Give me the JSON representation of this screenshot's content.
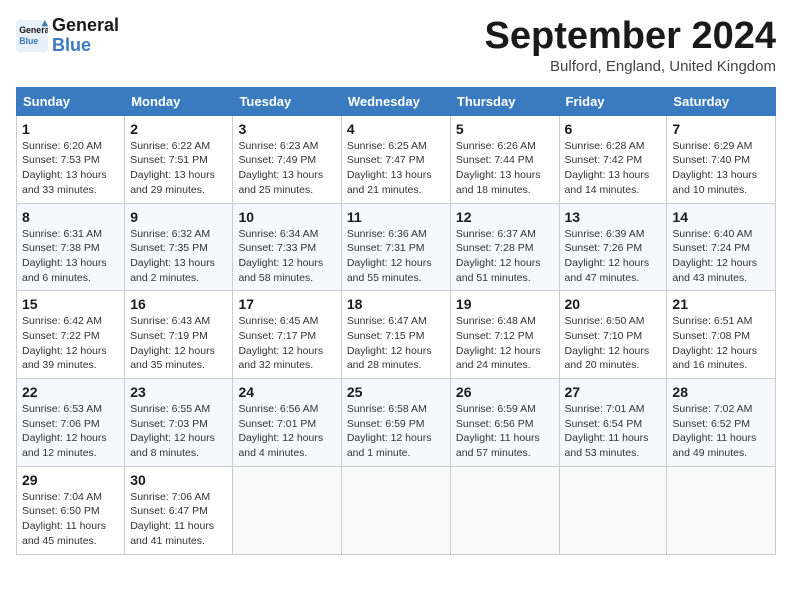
{
  "logo": {
    "line1": "General",
    "line2": "Blue"
  },
  "title": "September 2024",
  "location": "Bulford, England, United Kingdom",
  "days_header": [
    "Sunday",
    "Monday",
    "Tuesday",
    "Wednesday",
    "Thursday",
    "Friday",
    "Saturday"
  ],
  "weeks": [
    [
      {
        "num": "1",
        "info": "Sunrise: 6:20 AM\nSunset: 7:53 PM\nDaylight: 13 hours\nand 33 minutes."
      },
      {
        "num": "2",
        "info": "Sunrise: 6:22 AM\nSunset: 7:51 PM\nDaylight: 13 hours\nand 29 minutes."
      },
      {
        "num": "3",
        "info": "Sunrise: 6:23 AM\nSunset: 7:49 PM\nDaylight: 13 hours\nand 25 minutes."
      },
      {
        "num": "4",
        "info": "Sunrise: 6:25 AM\nSunset: 7:47 PM\nDaylight: 13 hours\nand 21 minutes."
      },
      {
        "num": "5",
        "info": "Sunrise: 6:26 AM\nSunset: 7:44 PM\nDaylight: 13 hours\nand 18 minutes."
      },
      {
        "num": "6",
        "info": "Sunrise: 6:28 AM\nSunset: 7:42 PM\nDaylight: 13 hours\nand 14 minutes."
      },
      {
        "num": "7",
        "info": "Sunrise: 6:29 AM\nSunset: 7:40 PM\nDaylight: 13 hours\nand 10 minutes."
      }
    ],
    [
      {
        "num": "8",
        "info": "Sunrise: 6:31 AM\nSunset: 7:38 PM\nDaylight: 13 hours\nand 6 minutes."
      },
      {
        "num": "9",
        "info": "Sunrise: 6:32 AM\nSunset: 7:35 PM\nDaylight: 13 hours\nand 2 minutes."
      },
      {
        "num": "10",
        "info": "Sunrise: 6:34 AM\nSunset: 7:33 PM\nDaylight: 12 hours\nand 58 minutes."
      },
      {
        "num": "11",
        "info": "Sunrise: 6:36 AM\nSunset: 7:31 PM\nDaylight: 12 hours\nand 55 minutes."
      },
      {
        "num": "12",
        "info": "Sunrise: 6:37 AM\nSunset: 7:28 PM\nDaylight: 12 hours\nand 51 minutes."
      },
      {
        "num": "13",
        "info": "Sunrise: 6:39 AM\nSunset: 7:26 PM\nDaylight: 12 hours\nand 47 minutes."
      },
      {
        "num": "14",
        "info": "Sunrise: 6:40 AM\nSunset: 7:24 PM\nDaylight: 12 hours\nand 43 minutes."
      }
    ],
    [
      {
        "num": "15",
        "info": "Sunrise: 6:42 AM\nSunset: 7:22 PM\nDaylight: 12 hours\nand 39 minutes."
      },
      {
        "num": "16",
        "info": "Sunrise: 6:43 AM\nSunset: 7:19 PM\nDaylight: 12 hours\nand 35 minutes."
      },
      {
        "num": "17",
        "info": "Sunrise: 6:45 AM\nSunset: 7:17 PM\nDaylight: 12 hours\nand 32 minutes."
      },
      {
        "num": "18",
        "info": "Sunrise: 6:47 AM\nSunset: 7:15 PM\nDaylight: 12 hours\nand 28 minutes."
      },
      {
        "num": "19",
        "info": "Sunrise: 6:48 AM\nSunset: 7:12 PM\nDaylight: 12 hours\nand 24 minutes."
      },
      {
        "num": "20",
        "info": "Sunrise: 6:50 AM\nSunset: 7:10 PM\nDaylight: 12 hours\nand 20 minutes."
      },
      {
        "num": "21",
        "info": "Sunrise: 6:51 AM\nSunset: 7:08 PM\nDaylight: 12 hours\nand 16 minutes."
      }
    ],
    [
      {
        "num": "22",
        "info": "Sunrise: 6:53 AM\nSunset: 7:06 PM\nDaylight: 12 hours\nand 12 minutes."
      },
      {
        "num": "23",
        "info": "Sunrise: 6:55 AM\nSunset: 7:03 PM\nDaylight: 12 hours\nand 8 minutes."
      },
      {
        "num": "24",
        "info": "Sunrise: 6:56 AM\nSunset: 7:01 PM\nDaylight: 12 hours\nand 4 minutes."
      },
      {
        "num": "25",
        "info": "Sunrise: 6:58 AM\nSunset: 6:59 PM\nDaylight: 12 hours\nand 1 minute."
      },
      {
        "num": "26",
        "info": "Sunrise: 6:59 AM\nSunset: 6:56 PM\nDaylight: 11 hours\nand 57 minutes."
      },
      {
        "num": "27",
        "info": "Sunrise: 7:01 AM\nSunset: 6:54 PM\nDaylight: 11 hours\nand 53 minutes."
      },
      {
        "num": "28",
        "info": "Sunrise: 7:02 AM\nSunset: 6:52 PM\nDaylight: 11 hours\nand 49 minutes."
      }
    ],
    [
      {
        "num": "29",
        "info": "Sunrise: 7:04 AM\nSunset: 6:50 PM\nDaylight: 11 hours\nand 45 minutes."
      },
      {
        "num": "30",
        "info": "Sunrise: 7:06 AM\nSunset: 6:47 PM\nDaylight: 11 hours\nand 41 minutes."
      },
      {
        "num": "",
        "info": ""
      },
      {
        "num": "",
        "info": ""
      },
      {
        "num": "",
        "info": ""
      },
      {
        "num": "",
        "info": ""
      },
      {
        "num": "",
        "info": ""
      }
    ]
  ]
}
